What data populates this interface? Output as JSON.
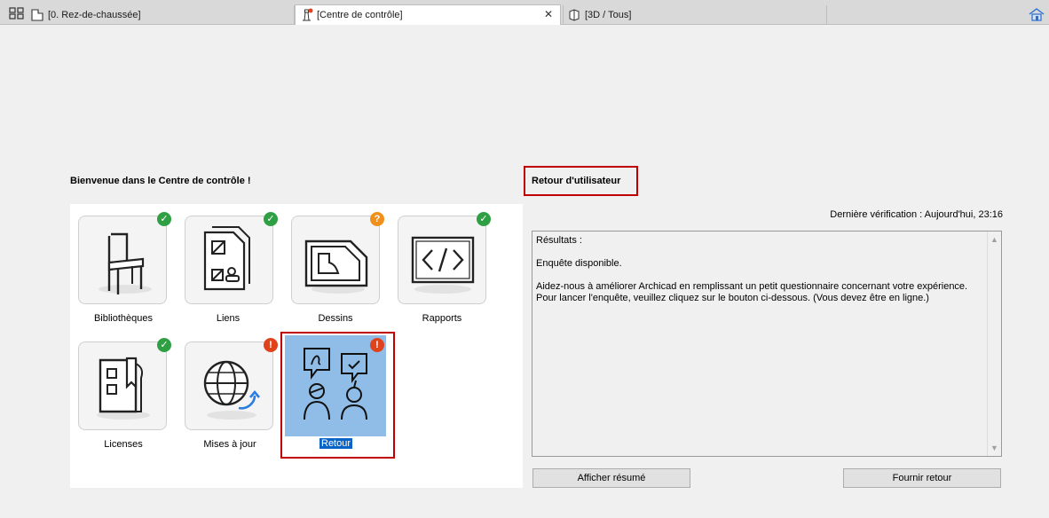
{
  "tabs": [
    {
      "label": "[0. Rez-de-chaussée]",
      "icon": "floorplan-icon"
    },
    {
      "label": "[Centre de contrôle]",
      "icon": "lighthouse-icon",
      "close": "✕"
    },
    {
      "label": "[3D / Tous]",
      "icon": "3d-view-icon"
    }
  ],
  "left": {
    "title": "Bienvenue dans le Centre de contrôle !",
    "tiles": [
      {
        "label": "Bibliothèques",
        "status": "ok",
        "badge": "✓"
      },
      {
        "label": "Liens",
        "status": "ok",
        "badge": "✓"
      },
      {
        "label": "Dessins",
        "status": "unknown",
        "badge": "?"
      },
      {
        "label": "Rapports",
        "status": "ok",
        "badge": "✓"
      },
      {
        "label": "Licenses",
        "status": "ok",
        "badge": "✓"
      },
      {
        "label": "Mises à jour",
        "status": "error",
        "badge": "!"
      },
      {
        "label": "Retour",
        "status": "error",
        "badge": "!",
        "selected": true
      }
    ]
  },
  "right": {
    "title": "Retour d'utilisateur",
    "last_check": "Dernière vérification : Aujourd'hui, 23:16",
    "results": [
      "Résultats :",
      "Enquête disponible.",
      "Aidez-nous à améliorer Archicad en remplissant un petit questionnaire concernant votre expérience. Pour lancer l'enquête, veuillez cliquez sur le bouton ci-dessous. (Vous devez être en ligne.)"
    ],
    "show_summary_button": "Afficher résumé",
    "provide_feedback_button": "Fournir retour"
  },
  "colors": {
    "ok": "#2ea043",
    "warn": "#f0901a",
    "error": "#e0431c",
    "highlight": "#c00000",
    "selection": "#0a64c8"
  }
}
